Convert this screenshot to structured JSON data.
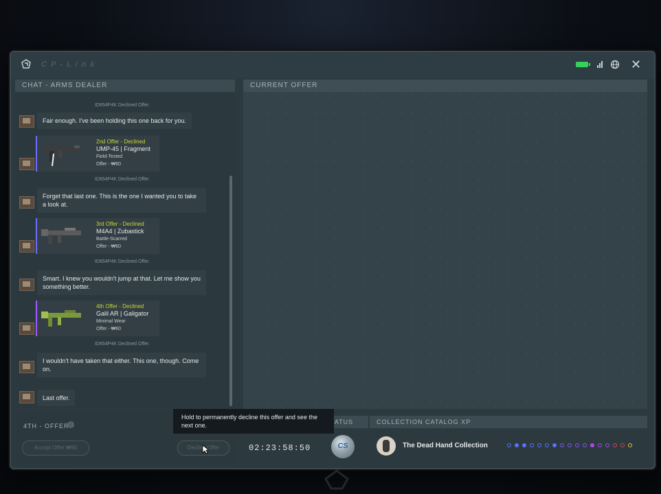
{
  "window": {
    "brand": "CP-Link",
    "close_icon": "close-icon",
    "status_icons": [
      "battery-icon",
      "signal-icon",
      "globe-icon"
    ]
  },
  "chat": {
    "header": "CHAT - ARMS DEALER",
    "top_note": "ID654P4K Declined Offer.",
    "messages": [
      "Fair enough. I've been holding this one back for you.",
      "Forget that last one. This is the one I wanted you to take a look at.",
      "Smart. I knew you wouldn't jump at that. Let me show you something better.",
      "I wouldn't have taken that either. This one, though. Come on.",
      "Last offer."
    ],
    "offers": [
      {
        "status": "2nd Offer - Declined",
        "name": "UMP-45 | Fragment",
        "wear": "Field-Tested",
        "price": "Offer - ₩60"
      },
      {
        "status": "3rd Offer - Declined",
        "name": "M4A4 | Zubastick",
        "wear": "Battle-Scarred",
        "price": "Offer - ₩60"
      },
      {
        "status": "4th Offer - Declined",
        "name": "Galil AR | Galigator",
        "wear": "Minimal Wear",
        "price": "Offer - ₩60"
      }
    ],
    "declined_note": "ID654P4K Declined Offer."
  },
  "current_offer": {
    "header": "CURRENT OFFER"
  },
  "footer": {
    "offer_label": "4TH - OFFER",
    "accept_button": "Accept Offer ₩90",
    "decline_button": "Decline Offer",
    "tooltip": "Hold to permanently decline this offer and see the next one.",
    "timer": "02:23:58:50",
    "status_header": "STATUS",
    "status_badge": "CS"
  },
  "collection": {
    "header": "COLLECTION CATALOG XP",
    "name": "The Dead Hand Collection",
    "dot_colors": [
      "#5a72ff",
      "#5a72ff",
      "#5a72ff",
      "#5a72ff",
      "#5a72ff",
      "#5a72ff",
      "#5a72ff",
      "#8a55ff",
      "#8a55ff",
      "#8a55ff",
      "#8a55ff",
      "#b047e6",
      "#b047e6",
      "#b047e6",
      "#e0404a",
      "#e0404a",
      "#e8c630"
    ],
    "dot_filled": [
      false,
      true,
      true,
      false,
      false,
      false,
      true,
      false,
      false,
      false,
      false,
      true,
      false,
      false,
      false,
      false,
      false
    ]
  }
}
